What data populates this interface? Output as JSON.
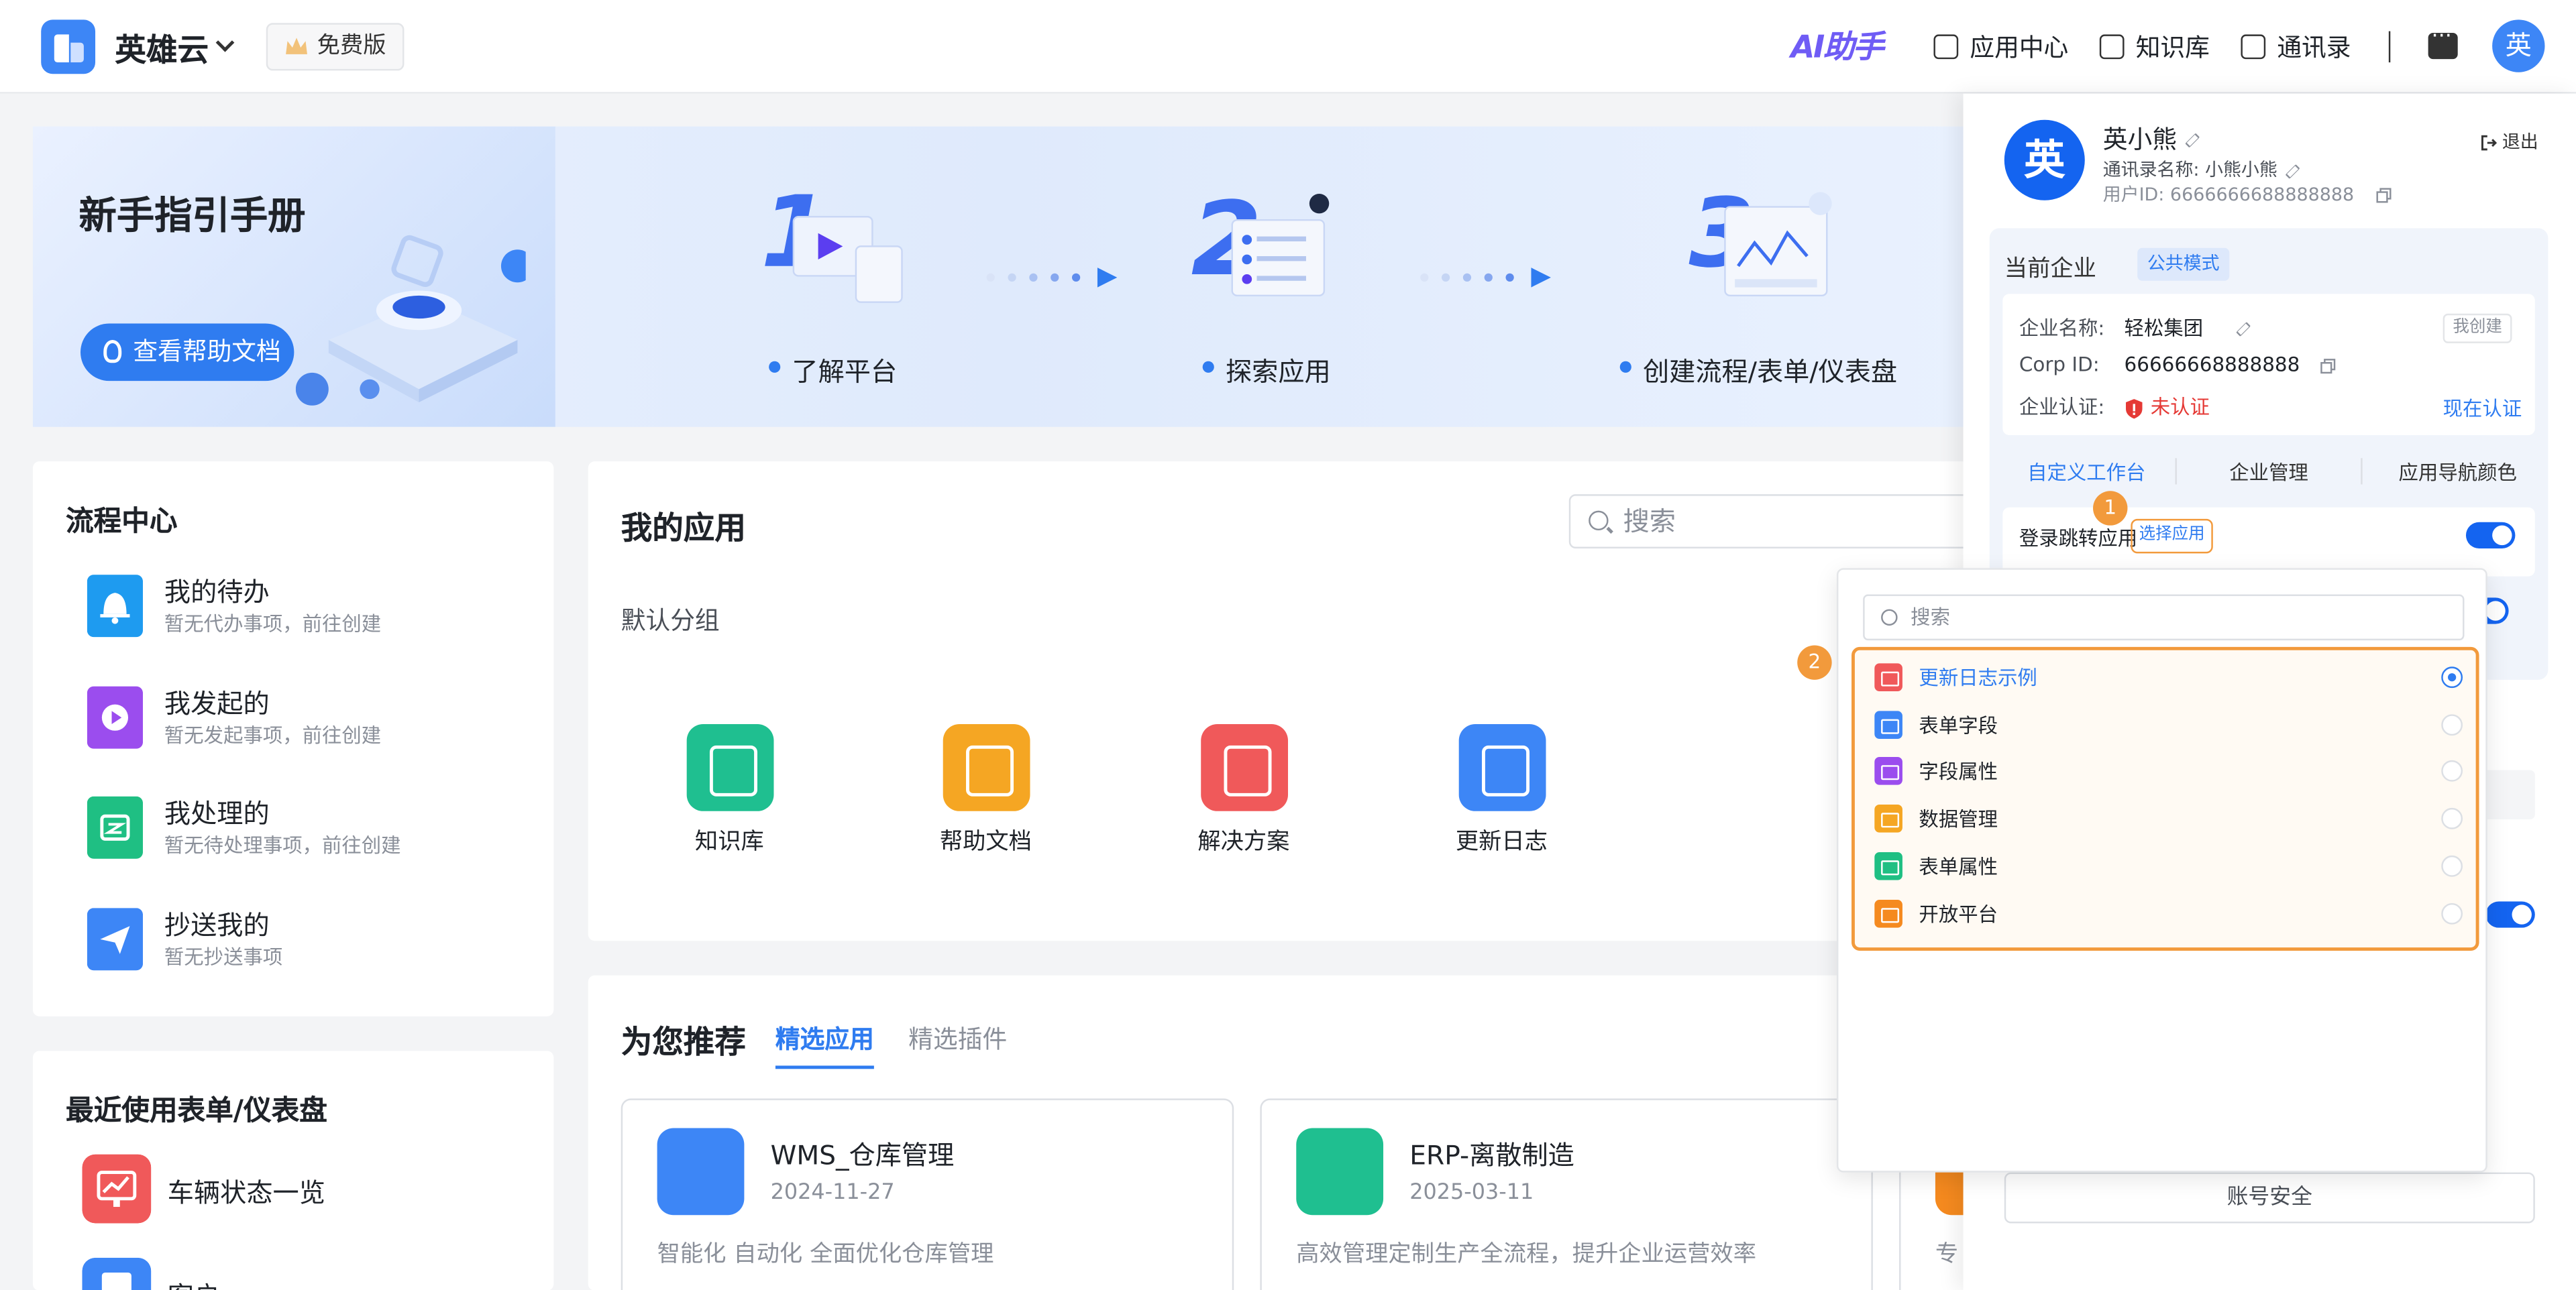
{
  "header": {
    "brand": "英雄云",
    "plan": "免费版",
    "ai_logo": "AI助手",
    "nav": [
      {
        "label": "应用中心",
        "icon": "app-center-icon"
      },
      {
        "label": "知识库",
        "icon": "book-icon"
      },
      {
        "label": "通讯录",
        "icon": "contacts-icon"
      }
    ],
    "avatar": "英"
  },
  "banner": {
    "title": "新手指引手册",
    "help_button": "查看帮助文档",
    "steps": [
      "了解平台",
      "探索应用",
      "创建流程/表单/仪表盘"
    ]
  },
  "flow_center": {
    "title": "流程中心",
    "items": [
      {
        "label": "我的待办",
        "sub": "暂无代办事项，前往创建",
        "color": "#1e9bf0"
      },
      {
        "label": "我发起的",
        "sub": "暂无发起事项，前往创建",
        "color": "#9b4dee"
      },
      {
        "label": "我处理的",
        "sub": "暂无待处理事项，前往创建",
        "color": "#1fbf83"
      },
      {
        "label": "抄送我的",
        "sub": "暂无抄送事项",
        "color": "#3d86f6"
      }
    ]
  },
  "recent": {
    "title": "最近使用表单/仪表盘",
    "items": [
      {
        "label": "车辆状态一览",
        "color": "#f0595a"
      },
      {
        "label": "客户",
        "color": "#3d86f6"
      }
    ]
  },
  "my_apps": {
    "title": "我的应用",
    "search_placeholder": "搜索",
    "group": "默认分组",
    "apps": [
      {
        "label": "知识库",
        "color": "#1fbf90"
      },
      {
        "label": "帮助文档",
        "color": "#f5a623"
      },
      {
        "label": "解决方案",
        "color": "#f0595a"
      },
      {
        "label": "更新日志",
        "color": "#3d86f6"
      }
    ]
  },
  "recommend": {
    "title": "为您推荐",
    "tabs": [
      "精选应用",
      "精选插件"
    ],
    "cards": [
      {
        "name": "WMS_仓库管理",
        "date": "2024-11-27",
        "desc": "智能化 自动化 全面优化仓库管理",
        "color": "#3d86f6"
      },
      {
        "name": "ERP-离散制造",
        "date": "2025-03-11",
        "desc": "高效管理定制生产全流程，提升企业运营效率",
        "color": "#1fbf90"
      },
      {
        "name": "",
        "date": "",
        "desc": "专",
        "color": "#f58a1f"
      }
    ]
  },
  "profile_panel": {
    "avatar": "英",
    "name": "英小熊",
    "contact_name": "通讯录名称: 小熊小熊",
    "user_id": "用户ID: 6666666688888888",
    "logout": "退出",
    "current_enterprise": "当前企业",
    "mode_tag": "公共模式",
    "ent_name_label": "企业名称:",
    "ent_name": "轻松集团",
    "created_tag": "我创建",
    "corp_id_label": "Corp ID:",
    "corp_id": "66666668888888",
    "cert_label": "企业认证:",
    "cert_status": "未认证",
    "cert_action": "现在认证",
    "tabs": [
      "自定义工作台",
      "企业管理",
      "应用导航颜色"
    ],
    "setting_label": "登录跳转应用",
    "choose_app": "选择应用",
    "account_security": "账号安全"
  },
  "markers": [
    "1",
    "2"
  ],
  "dropdown": {
    "search_placeholder": "搜索",
    "items": [
      {
        "label": "更新日志示例",
        "color": "#f0595a",
        "selected": true
      },
      {
        "label": "表单字段",
        "color": "#3d86f6",
        "selected": false
      },
      {
        "label": "字段属性",
        "color": "#9b4dee",
        "selected": false
      },
      {
        "label": "数据管理",
        "color": "#f5a623",
        "selected": false
      },
      {
        "label": "表单属性",
        "color": "#1fbf83",
        "selected": false
      },
      {
        "label": "开放平台",
        "color": "#f58a1f",
        "selected": false
      }
    ]
  }
}
